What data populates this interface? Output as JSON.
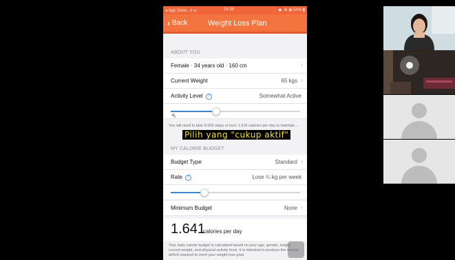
{
  "status_bar": {
    "left": "◂ App Store ..ıl ᯤ",
    "time": "14.08",
    "right": "⏰ ⊕ ◉ 54% ▮"
  },
  "nav": {
    "back_label": "Back",
    "title": "Weight Loss Plan"
  },
  "about_you": {
    "header": "ABOUT YOU",
    "profile": "Female · 34 years old · 160 cm",
    "current_weight_label": "Current Weight",
    "current_weight_value": "65 kgs",
    "activity_label": "Activity Level",
    "activity_value": "Somewhat Active",
    "activity_slider_fraction": 0.35,
    "note": "You will need to take 8.000 steps or burn 1.916 calories per day to maintain..."
  },
  "subtitle": "Pilih yang \"cukup aktif\"",
  "calorie_budget": {
    "header": "MY CALORIE BUDGET",
    "budget_type_label": "Budget Type",
    "budget_type_value": "Standard",
    "rate_label": "Rate",
    "rate_value": "Lose ¼ kg per week",
    "rate_slider_fraction": 0.26,
    "minimum_budget_label": "Minimum Budget",
    "minimum_budget_value": "None",
    "calories_number": "1.641",
    "calories_unit": "calories per day",
    "note": "Your daily calorie budget is calculated based on your age, gender, height, current weight, and physical activity level. It is intended to produce the energy deficit required to meet your weight loss goal."
  },
  "icons": {
    "back": "chevron-left-icon",
    "help": "question-circle-icon",
    "arrow": "chevron-right-icon",
    "cursor": "pointer-cursor-icon"
  },
  "colors": {
    "brand_orange": "#f4743f",
    "slider_blue": "#3b86d4",
    "subtitle_yellow": "#f4e23a"
  }
}
